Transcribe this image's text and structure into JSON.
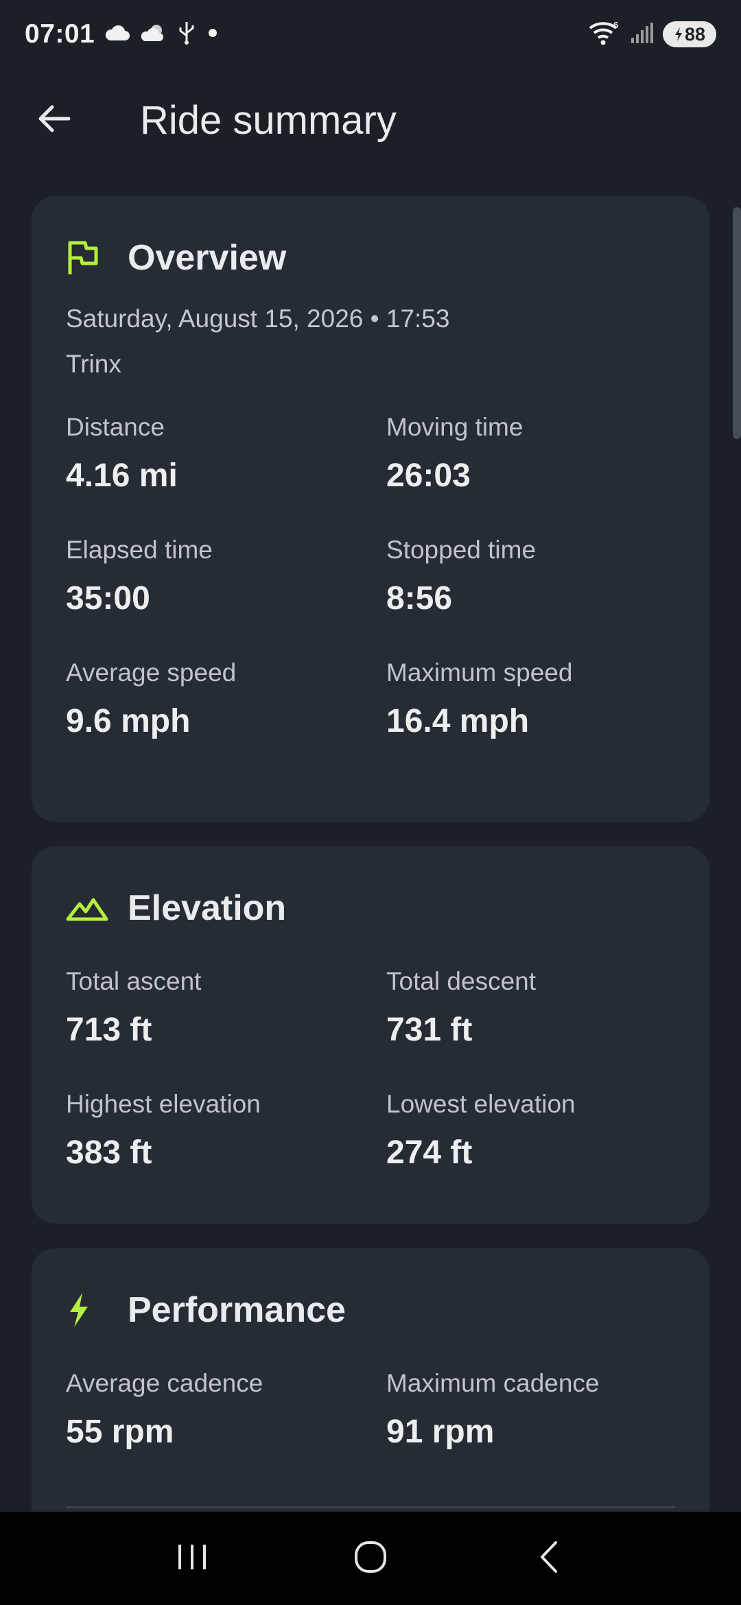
{
  "status_bar": {
    "time": "07:01",
    "battery_level": "88",
    "icons": [
      "cloud-icon",
      "weather-icon",
      "usb-icon",
      "dot-icon",
      "wifi-icon",
      "signal-icon",
      "battery-icon"
    ]
  },
  "app_bar": {
    "title": "Ride summary",
    "back_icon": "arrow-left-icon"
  },
  "overview": {
    "title": "Overview",
    "icon": "flag-icon",
    "date": "Saturday, August 15, 2026 • 17:53",
    "bike": "Trinx",
    "stats": [
      {
        "label": "Distance",
        "value": "4.16 mi"
      },
      {
        "label": "Moving time",
        "value": "26:03"
      },
      {
        "label": "Elapsed time",
        "value": "35:00"
      },
      {
        "label": "Stopped time",
        "value": "8:56"
      },
      {
        "label": "Average speed",
        "value": "9.6 mph"
      },
      {
        "label": "Maximum speed",
        "value": "16.4 mph"
      }
    ]
  },
  "elevation": {
    "title": "Elevation",
    "icon": "mountain-icon",
    "stats": [
      {
        "label": "Total ascent",
        "value": "713 ft"
      },
      {
        "label": "Total descent",
        "value": "731 ft"
      },
      {
        "label": "Highest elevation",
        "value": "383 ft"
      },
      {
        "label": "Lowest elevation",
        "value": "274 ft"
      }
    ]
  },
  "performance": {
    "title": "Performance",
    "icon": "bolt-icon",
    "stats": [
      {
        "label": "Average cadence",
        "value": "55 rpm"
      },
      {
        "label": "Maximum cadence",
        "value": "91 rpm"
      }
    ]
  },
  "nav_bar": {
    "buttons": [
      "recents-icon",
      "home-icon",
      "back-icon"
    ]
  },
  "colors": {
    "accent": "#b6ef3c",
    "background": "#1b2026",
    "card": "#262c33"
  }
}
